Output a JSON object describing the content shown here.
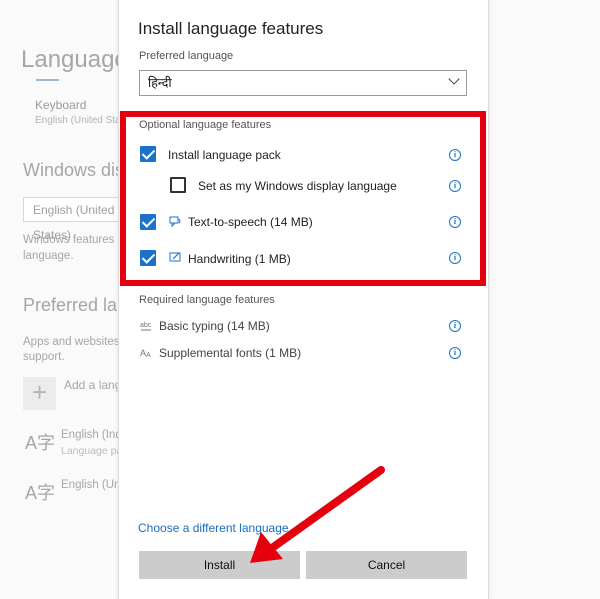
{
  "background": {
    "title": "Language",
    "keyboard_label": "Keyboard",
    "keyboard_sub": "English (United States)",
    "windows_display_heading": "Windows display language",
    "windows_display_value": "English (United States)",
    "windows_display_desc": [
      "Windows features like Settings and File Explorer will appear in this",
      "language."
    ],
    "preferred_heading": "Preferred languages",
    "preferred_desc": [
      "Apps and websites will appear in the first language in the list that they",
      "support."
    ],
    "add_label": "Add a language",
    "add_icon": "+",
    "lang_icon": "A字",
    "languages": [
      {
        "name": "English (India)",
        "sub": "Language pack available"
      },
      {
        "name": "English (United States)",
        "sub": ""
      }
    ]
  },
  "dialog": {
    "title": "Install language features",
    "preferred_label": "Preferred language",
    "preferred_value": "हिन्दी",
    "optional_title": "Optional language features",
    "optional": [
      {
        "label": "Install language pack",
        "checked": true,
        "icon": ""
      },
      {
        "label": "Set as my Windows display language",
        "checked": false,
        "icon": ""
      },
      {
        "label": "Text-to-speech (14 MB)",
        "checked": true,
        "icon": "speech-icon"
      },
      {
        "label": "Handwriting (1 MB)",
        "checked": true,
        "icon": "pen-icon"
      }
    ],
    "required_title": "Required language features",
    "required": [
      {
        "label": "Basic typing (14 MB)",
        "icon": "typing-icon"
      },
      {
        "label": "Supplemental fonts (1 MB)",
        "icon": "font-icon"
      }
    ],
    "info_glyph": "i",
    "change_link": "Choose a different language",
    "install_label": "Install",
    "cancel_label": "Cancel"
  },
  "colors": {
    "accent": "#1a73c9",
    "annotation_red": "#e5000d",
    "button_gray": "#cccccc"
  }
}
